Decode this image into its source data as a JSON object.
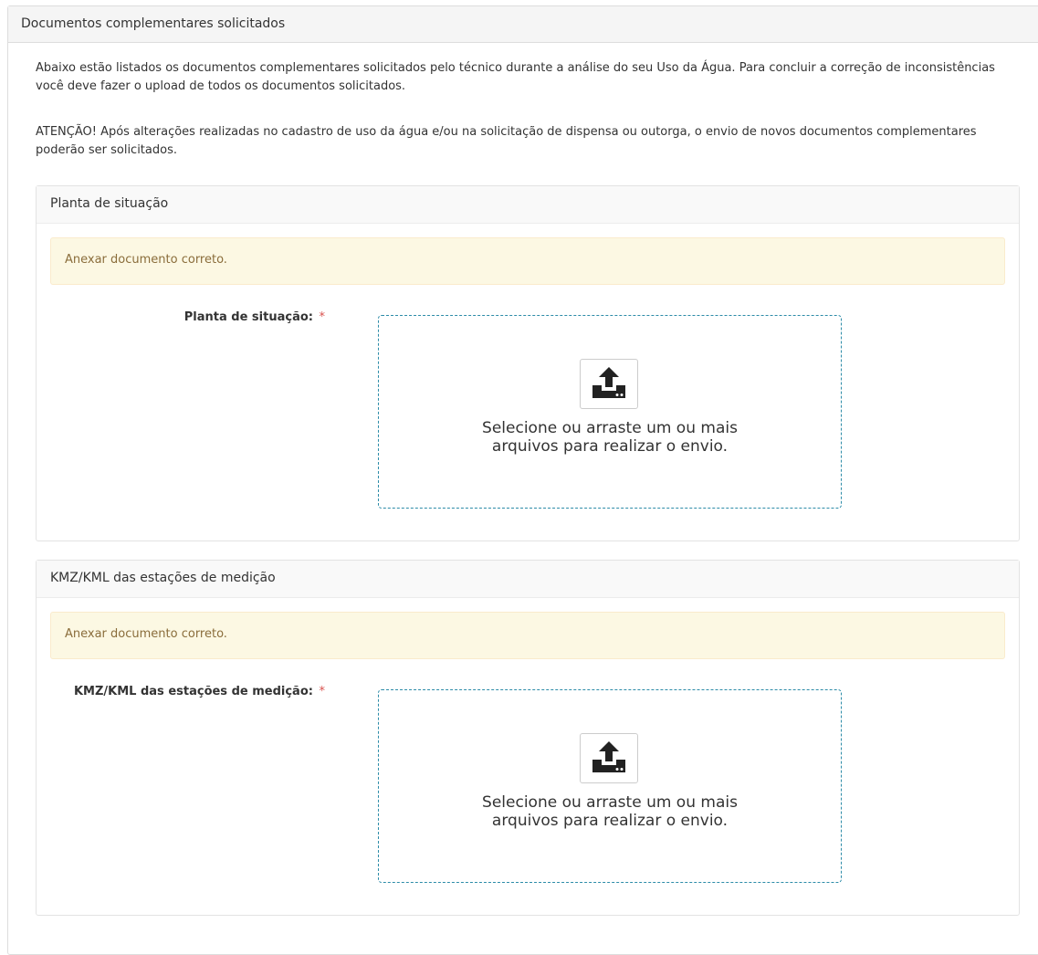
{
  "panel": {
    "title": "Documentos complementares solicitados",
    "intro": "Abaixo estão listados os documentos complementares solicitados pelo técnico durante a análise do seu Uso da Água. Para concluir a correção de inconsistências você deve fazer o upload de todos os documentos solicitados.",
    "warning": "ATENÇÃO! Após alterações realizadas no cadastro de uso da água e/ou na solicitação de dispensa ou outorga, o envio de novos documentos complementares poderão ser solicitados."
  },
  "documents": [
    {
      "title": "Planta de situação",
      "alert": "Anexar documento correto.",
      "field_label": "Planta de situação:",
      "required": "*",
      "dropzone_line1": "Selecione ou arraste um ou mais",
      "dropzone_line2": "arquivos para realizar o envio.",
      "icon": "upload-icon"
    },
    {
      "title": "KMZ/KML das estações de medição",
      "alert": "Anexar documento correto.",
      "field_label": "KMZ/KML das estações de medição:",
      "required": "*",
      "dropzone_line1": "Selecione ou arraste um ou mais",
      "dropzone_line2": "arquivos para realizar o envio.",
      "icon": "upload-icon"
    }
  ],
  "colors": {
    "alert_background": "#fcf8e3",
    "alert_text": "#8a6d3b",
    "required": "#d9534f",
    "dropzone_border": "#2d8ca8"
  }
}
